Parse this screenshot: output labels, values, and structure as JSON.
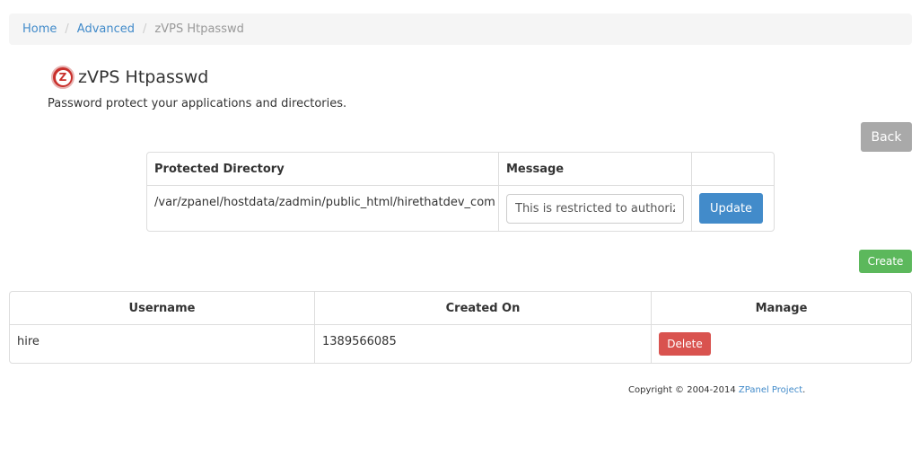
{
  "breadcrumb": {
    "home": "Home",
    "advanced": "Advanced",
    "current": "zVPS Htpasswd",
    "separator": "/"
  },
  "header": {
    "title": "zVPS Htpasswd",
    "subtitle": "Password protect your applications and directories.",
    "logo_letter": "Z"
  },
  "buttons": {
    "back": "Back",
    "update": "Update",
    "create": "Create",
    "delete": "Delete"
  },
  "directory_table": {
    "headers": [
      "Protected Directory",
      "Message",
      ""
    ],
    "rows": [
      {
        "directory": "/var/zpanel/hostdata/zadmin/public_html/hirethatdev_com",
        "message": "This is restricted to authorized"
      }
    ]
  },
  "user_table": {
    "headers": [
      "Username",
      "Created On",
      "Manage"
    ],
    "rows": [
      {
        "username": "hire",
        "created_on": "1389566085"
      }
    ]
  },
  "footer": {
    "copyright": "Copyright © 2004-2014",
    "link_text": "ZPanel Project",
    "suffix": "."
  },
  "colors": {
    "primary": "#428bca",
    "success": "#5cb85c",
    "danger": "#d9534f",
    "back_button": "#a9a9a9",
    "breadcrumb_bg": "#f5f5f5",
    "logo": "#c9302c"
  }
}
